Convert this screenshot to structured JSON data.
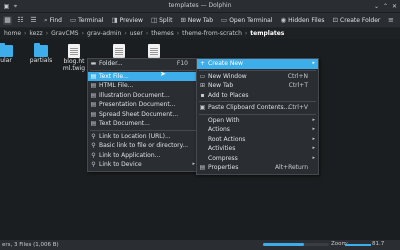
{
  "window": {
    "title": "templates — Dolphin"
  },
  "toolbar": {
    "find_label": "Find",
    "terminal_label": "Terminal",
    "preview_label": "Preview",
    "split_label": "Split",
    "new_tab_label": "New Tab",
    "open_terminal_label": "Open Terminal",
    "hidden_files_label": "Hidden Files",
    "create_folder_label": "Create Folder"
  },
  "breadcrumb": {
    "items": [
      "home",
      "kezz",
      "GravCMS",
      "grav-admin",
      "user",
      "themes",
      "theme-from-scratch",
      "templates"
    ]
  },
  "files": [
    {
      "name": "ular",
      "kind": "folder"
    },
    {
      "name": "partials",
      "kind": "folder"
    },
    {
      "name": "blog.html.twig",
      "kind": "doc"
    },
    {
      "name": "",
      "kind": "doc"
    },
    {
      "name": "",
      "kind": "doc"
    }
  ],
  "context_menu": {
    "items": [
      {
        "label": "Create New",
        "icon": "plus-icon",
        "has_submenu": true,
        "highlighted": true
      },
      {
        "label": "New Window",
        "icon": "window-icon",
        "shortcut": "Ctrl+N"
      },
      {
        "label": "New Tab",
        "icon": "tab-icon",
        "shortcut": "Ctrl+T"
      },
      {
        "label": "Add to Places",
        "icon": "places-icon"
      },
      {
        "label": "Paste Clipboard Contents...",
        "icon": "paste-icon",
        "shortcut": "Ctrl+V"
      },
      {
        "label": "Open With",
        "has_submenu": true
      },
      {
        "label": "Actions",
        "has_submenu": true
      },
      {
        "label": "Root Actions",
        "has_submenu": true
      },
      {
        "label": "Activities",
        "has_submenu": true
      },
      {
        "label": "Compress",
        "has_submenu": true
      },
      {
        "label": "Properties",
        "icon": "properties-icon",
        "shortcut": "Alt+Return"
      }
    ]
  },
  "create_new_submenu": {
    "items": [
      {
        "label": "Folder...",
        "icon": "folder-icon",
        "shortcut": "F10"
      },
      {
        "label": "Text File...",
        "icon": "text-file-icon",
        "highlighted": true
      },
      {
        "label": "HTML File...",
        "icon": "html-file-icon"
      },
      {
        "label": "Illustration Document...",
        "icon": "illustration-icon"
      },
      {
        "label": "Presentation Document...",
        "icon": "presentation-icon"
      },
      {
        "label": "Spread Sheet Document...",
        "icon": "spreadsheet-icon"
      },
      {
        "label": "Text Document...",
        "icon": "text-document-icon"
      },
      {
        "label": "Link to Location (URL)...",
        "icon": "link-icon"
      },
      {
        "label": "Basic link to file or directory...",
        "icon": "link-icon"
      },
      {
        "label": "Link to Application...",
        "icon": "link-icon"
      },
      {
        "label": "Link to Device",
        "icon": "link-icon",
        "has_submenu": true
      }
    ]
  },
  "statusbar": {
    "text": "ers, 3 Files (1,006 B)",
    "progress_fraction": 0.62,
    "zoom_label": "Zoom:",
    "free_space": "81.7"
  },
  "colors": {
    "accent": "#3daee9",
    "window_bg": "#1b1e20",
    "menu_bg": "#2a2e32"
  }
}
